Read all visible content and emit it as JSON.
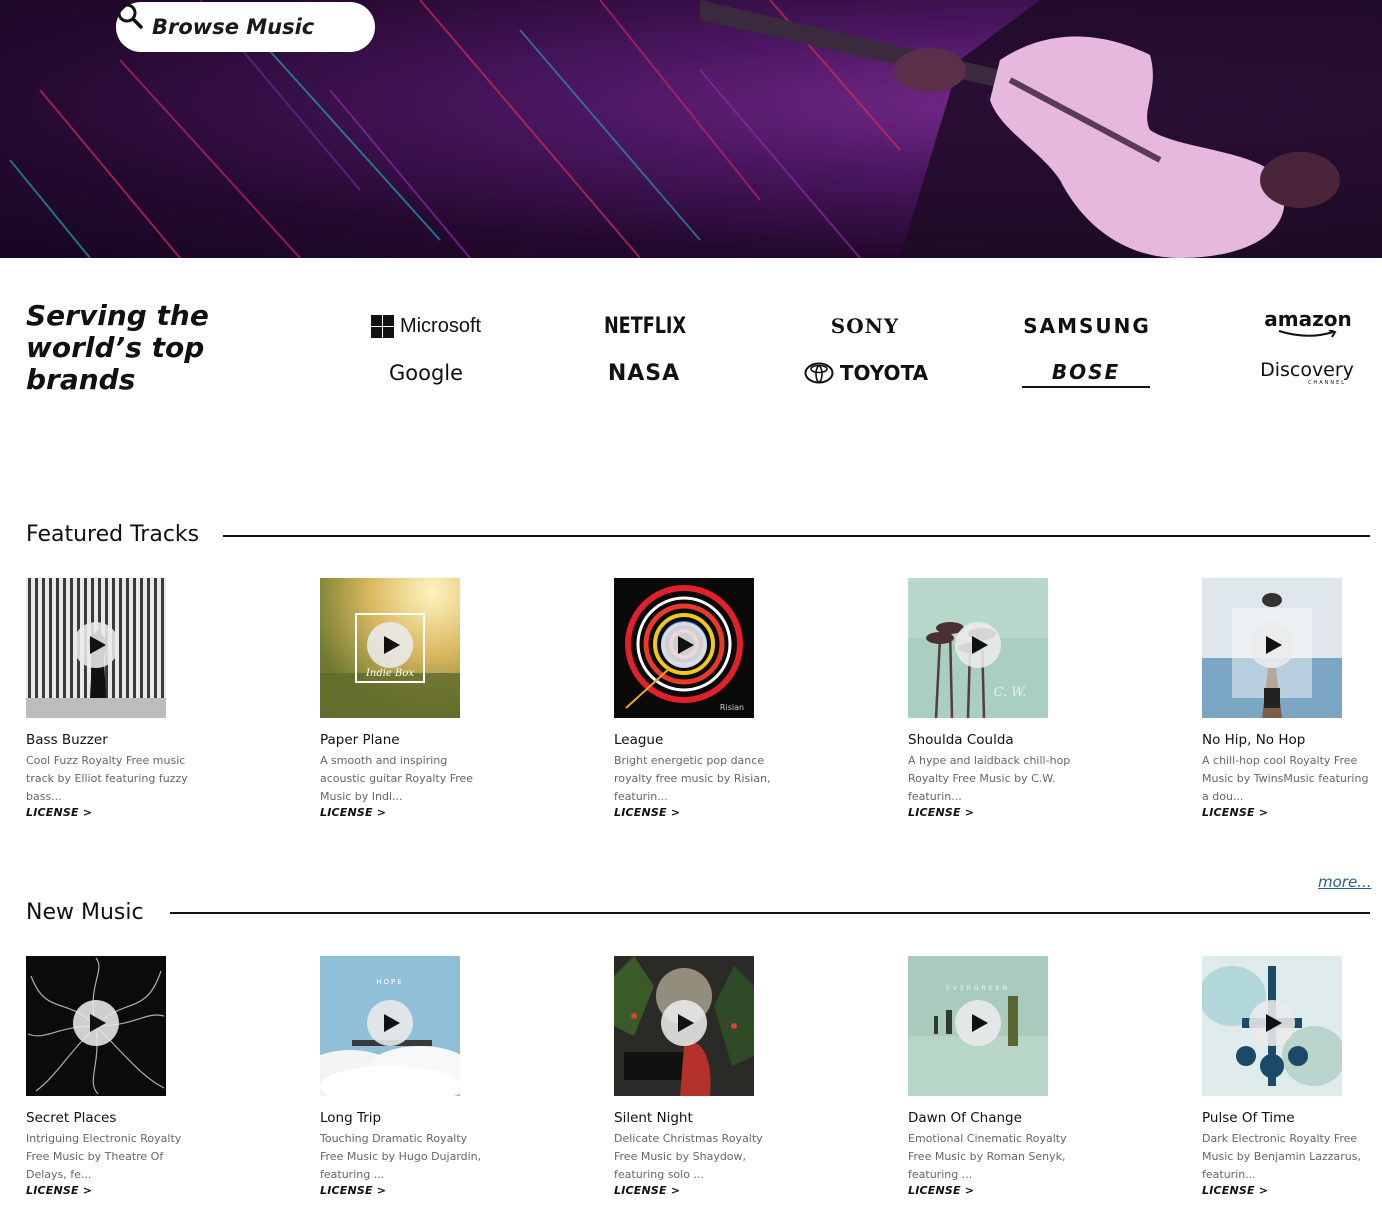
{
  "hero": {
    "browse_label": "Browse Music"
  },
  "brands": {
    "heading_line1": "Serving the",
    "heading_line2": "world’s top",
    "heading_line3": "brands",
    "logos": [
      "Microsoft",
      "NETFLIX",
      "SONY",
      "SAMSUNG",
      "amazon",
      "Google",
      "NASA",
      "TOYOTA",
      "BOSE",
      "Discovery"
    ],
    "discovery_sub": "CHANNEL"
  },
  "featured": {
    "title": "Featured Tracks",
    "more_label": "more...",
    "tracks": [
      {
        "title": "Bass Buzzer",
        "desc": "Cool Fuzz Royalty Free music track by Elliot featuring fuzzy bass...",
        "license": "LICENSE >"
      },
      {
        "title": "Paper Plane",
        "desc": "A smooth and inspiring acoustic guitar Royalty Free Music by Indi...",
        "license": "LICENSE >",
        "art_text": "Indie Box"
      },
      {
        "title": "League",
        "desc": "Bright energetic pop dance royalty free music by Risian, featurin...",
        "license": "LICENSE >",
        "art_text": "Risian"
      },
      {
        "title": "Shoulda Coulda",
        "desc": "A hype and laidback chill-hop Royalty Free Music by C.W. featurin...",
        "license": "LICENSE >",
        "art_text": "C. W."
      },
      {
        "title": "No Hip, No Hop",
        "desc": "A chill-hop cool Royalty Free Music by TwinsMusic featuring a dou...",
        "license": "LICENSE >"
      }
    ]
  },
  "new_music": {
    "title": "New Music",
    "tracks": [
      {
        "title": "Secret Places",
        "desc": "Intriguing Electronic Royalty Free Music by Theatre Of Delays, fe...",
        "license": "LICENSE >"
      },
      {
        "title": "Long Trip",
        "desc": "Touching Dramatic Royalty Free Music by Hugo Dujardin, featuring ...",
        "license": "LICENSE >",
        "art_text": "HOPE"
      },
      {
        "title": "Silent Night",
        "desc": "Delicate Christmas Royalty Free Music by Shaydow, featuring solo ...",
        "license": "LICENSE >"
      },
      {
        "title": "Dawn Of Change",
        "desc": "Emotional Cinematic Royalty Free Music by Roman Senyk, featuring ...",
        "license": "LICENSE >",
        "art_text": "EVERGREEN"
      },
      {
        "title": "Pulse Of Time",
        "desc": "Dark Electronic Royalty Free Music by Benjamin Lazzarus, featurin...",
        "license": "LICENSE >"
      }
    ]
  }
}
